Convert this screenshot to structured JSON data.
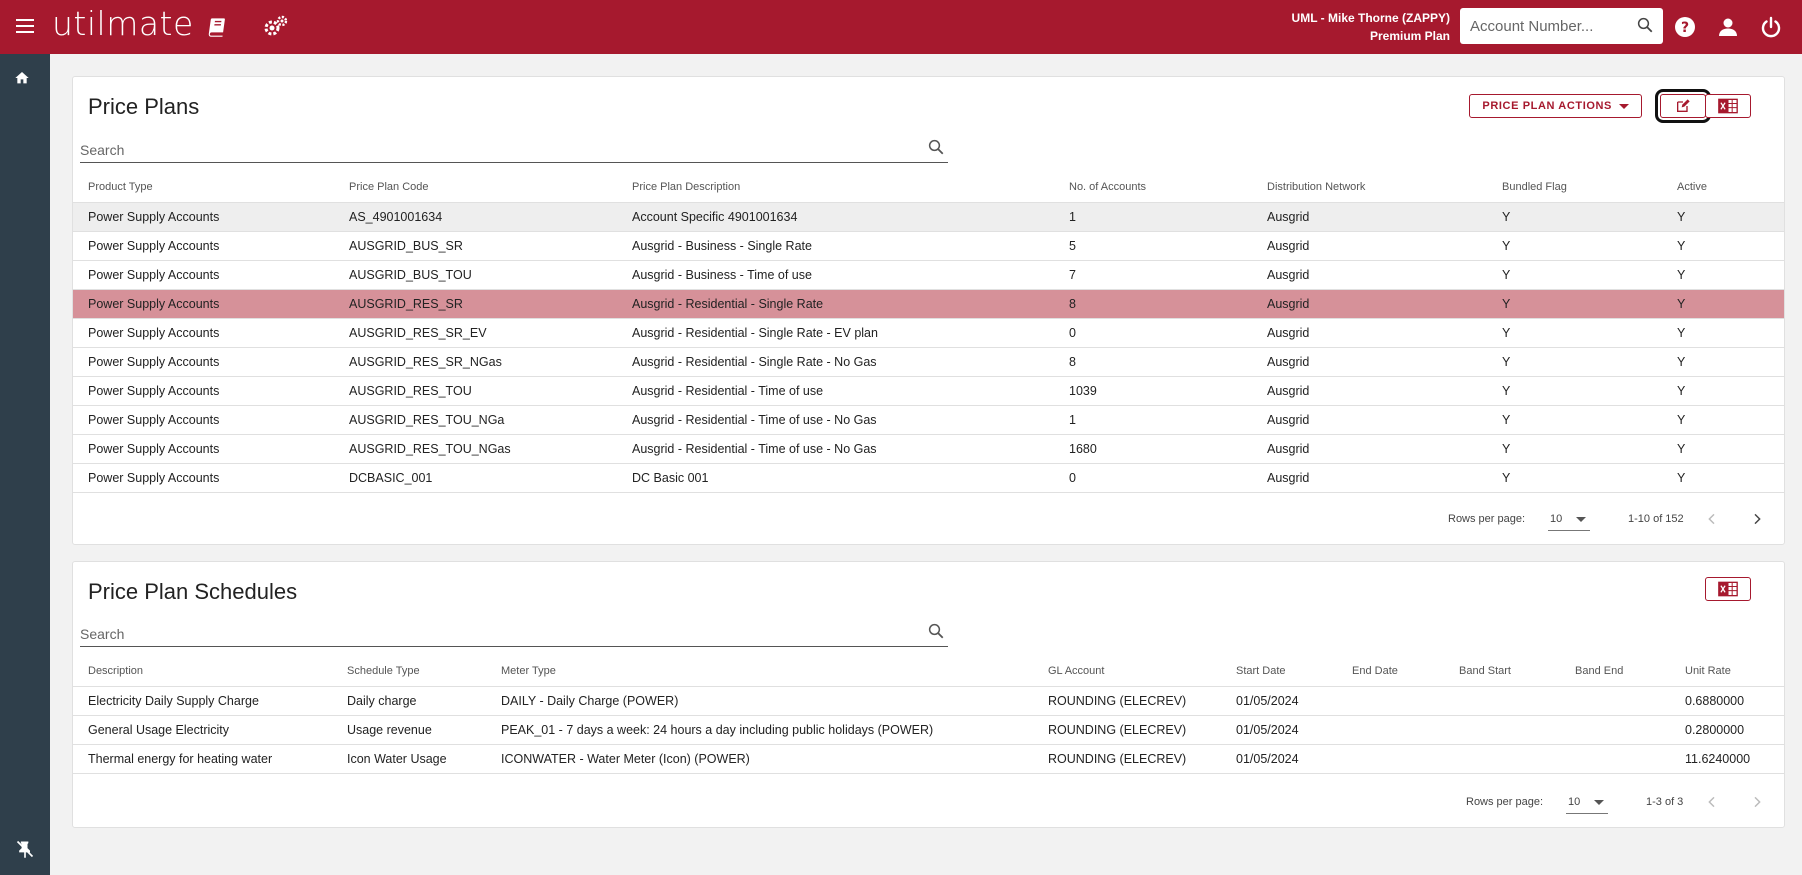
{
  "header": {
    "logo": "utilmate",
    "user_line1": "UML - Mike Thorne (ZAPPY)",
    "user_line2": "Premium Plan",
    "account_placeholder": "Account Number...",
    "brand_color": "#a6192e",
    "sidebar_color": "#2f3f4b"
  },
  "price_plans": {
    "title": "Price Plans",
    "actions_label": "PRICE PLAN ACTIONS",
    "search_placeholder": "Search",
    "columns": [
      "Product Type",
      "Price Plan Code",
      "Price Plan Description",
      "No. of Accounts",
      "Distribution Network",
      "Bundled Flag",
      "Active"
    ],
    "rows": [
      [
        "Power Supply Accounts",
        "AS_4901001634",
        "Account Specific 4901001634",
        "1",
        "Ausgrid",
        "Y",
        "Y"
      ],
      [
        "Power Supply Accounts",
        "AUSGRID_BUS_SR",
        "Ausgrid - Business - Single Rate",
        "5",
        "Ausgrid",
        "Y",
        "Y"
      ],
      [
        "Power Supply Accounts",
        "AUSGRID_BUS_TOU",
        "Ausgrid - Business - Time of use",
        "7",
        "Ausgrid",
        "Y",
        "Y"
      ],
      [
        "Power Supply Accounts",
        "AUSGRID_RES_SR",
        "Ausgrid - Residential - Single Rate",
        "8",
        "Ausgrid",
        "Y",
        "Y"
      ],
      [
        "Power Supply Accounts",
        "AUSGRID_RES_SR_EV",
        "Ausgrid - Residential - Single Rate - EV plan",
        "0",
        "Ausgrid",
        "Y",
        "Y"
      ],
      [
        "Power Supply Accounts",
        "AUSGRID_RES_SR_NGas",
        "Ausgrid - Residential - Single Rate - No Gas",
        "8",
        "Ausgrid",
        "Y",
        "Y"
      ],
      [
        "Power Supply Accounts",
        "AUSGRID_RES_TOU",
        "Ausgrid - Residential - Time of use",
        "1039",
        "Ausgrid",
        "Y",
        "Y"
      ],
      [
        "Power Supply Accounts",
        "AUSGRID_RES_TOU_NGa",
        "Ausgrid - Residential - Time of use - No Gas",
        "1",
        "Ausgrid",
        "Y",
        "Y"
      ],
      [
        "Power Supply Accounts",
        "AUSGRID_RES_TOU_NGas",
        "Ausgrid - Residential - Time of use - No Gas",
        "1680",
        "Ausgrid",
        "Y",
        "Y"
      ],
      [
        "Power Supply Accounts",
        "DCBASIC_001",
        "DC Basic 001",
        "0",
        "Ausgrid",
        "Y",
        "Y"
      ]
    ],
    "hover_row": 0,
    "selected_row": 3,
    "rows_per_page_label": "Rows per page:",
    "rows_per_page": "10",
    "range": "1-10 of 152"
  },
  "schedules": {
    "title": "Price Plan Schedules",
    "search_placeholder": "Search",
    "columns": [
      "Description",
      "Schedule Type",
      "Meter Type",
      "GL Account",
      "Start Date",
      "End Date",
      "Band Start",
      "Band End",
      "Unit Rate"
    ],
    "rows": [
      [
        "Electricity Daily Supply Charge",
        "Daily charge",
        "DAILY - Daily Charge (POWER)",
        "ROUNDING (ELECREV)",
        "01/05/2024",
        "",
        "",
        "",
        "0.6880000"
      ],
      [
        "General Usage Electricity",
        "Usage revenue",
        "PEAK_01 - 7 days a week: 24 hours a day including public holidays (POWER)",
        "ROUNDING (ELECREV)",
        "01/05/2024",
        "",
        "",
        "",
        "0.2800000"
      ],
      [
        "Thermal energy for heating water",
        "Icon Water Usage",
        "ICONWATER - Water Meter (Icon) (POWER)",
        "ROUNDING (ELECREV)",
        "01/05/2024",
        "",
        "",
        "",
        "11.6240000"
      ]
    ],
    "rows_per_page_label": "Rows per page:",
    "rows_per_page": "10",
    "range": "1-3 of 3"
  }
}
